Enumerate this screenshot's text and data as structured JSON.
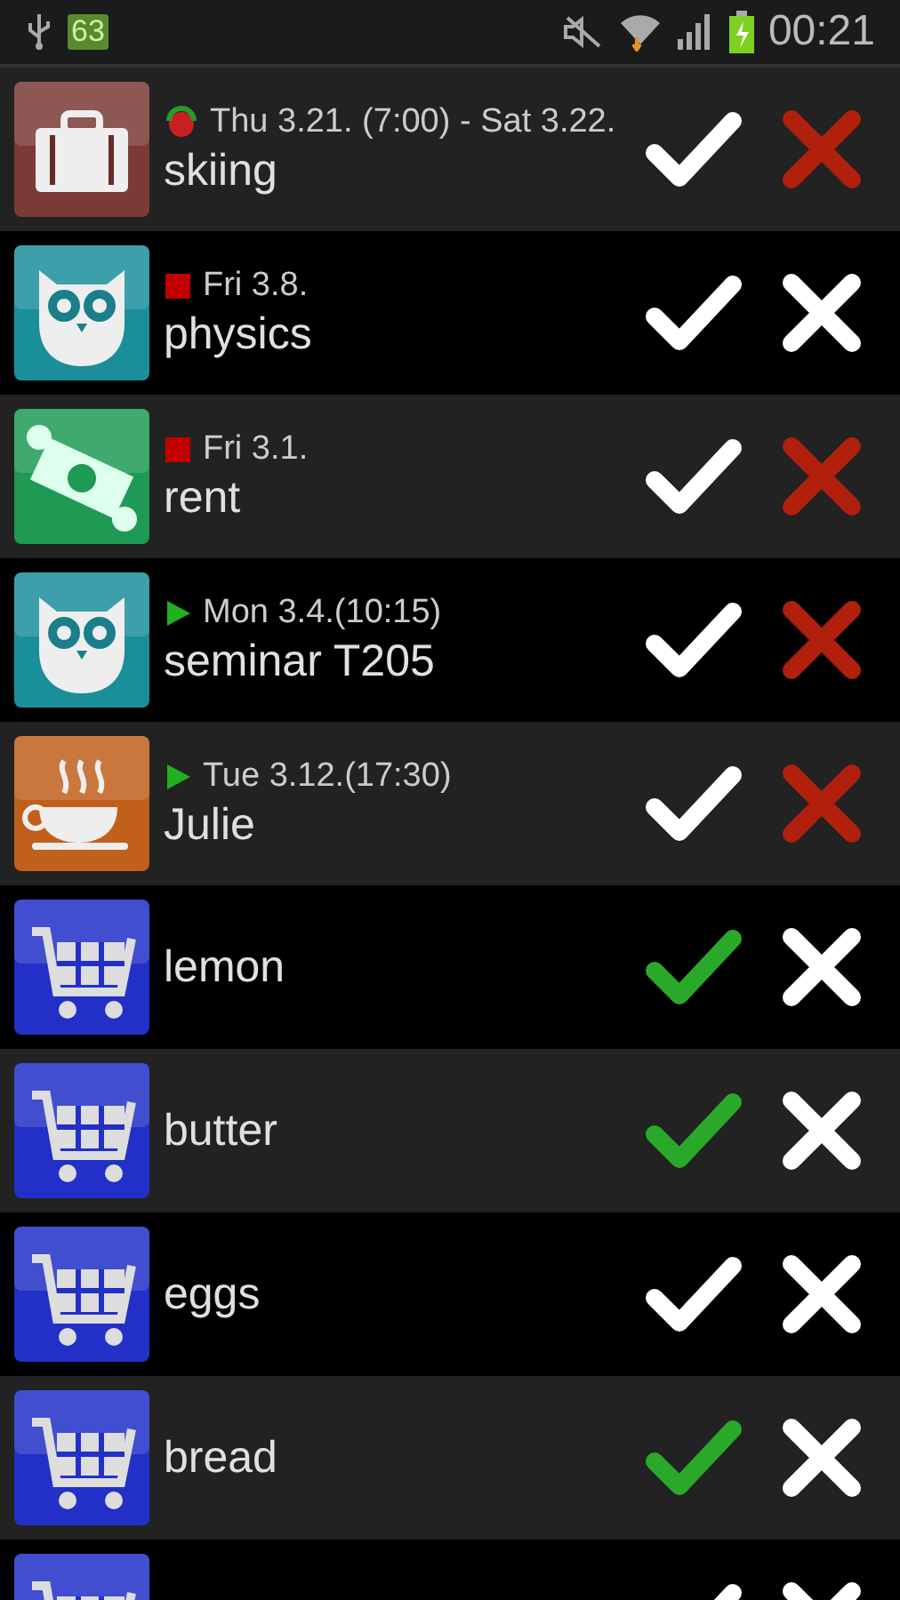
{
  "status_bar": {
    "battery_badge": "63",
    "time": "00:21"
  },
  "tasks": [
    {
      "kind": "suitcase",
      "marker": {
        "kind": "sync"
      },
      "date": "Thu 3.21. (7:00) - Sat 3.22.",
      "title": "skiing",
      "check_green": false,
      "cross_red": true
    },
    {
      "kind": "owl",
      "marker": {
        "kind": "square"
      },
      "date": "Fri 3.8.",
      "title": "physics",
      "check_green": false,
      "cross_red": false
    },
    {
      "kind": "money",
      "marker": {
        "kind": "square"
      },
      "date": "Fri 3.1.",
      "title": "rent",
      "check_green": false,
      "cross_red": true
    },
    {
      "kind": "owl",
      "marker": {
        "kind": "play"
      },
      "date": "Mon 3.4.(10:15)",
      "title": "seminar T205",
      "check_green": false,
      "cross_red": true
    },
    {
      "kind": "cup",
      "marker": {
        "kind": "play"
      },
      "date": "Tue 3.12.(17:30)",
      "title": "Julie",
      "check_green": false,
      "cross_red": true
    },
    {
      "kind": "cart",
      "title": "lemon",
      "check_green": true,
      "cross_red": false
    },
    {
      "kind": "cart",
      "title": "butter",
      "check_green": true,
      "cross_red": false
    },
    {
      "kind": "cart",
      "title": "eggs",
      "check_green": false,
      "cross_red": false
    },
    {
      "kind": "cart",
      "title": "bread",
      "check_green": true,
      "cross_red": false
    },
    {
      "kind": "cart",
      "check_green": false,
      "cross_red": false
    }
  ]
}
